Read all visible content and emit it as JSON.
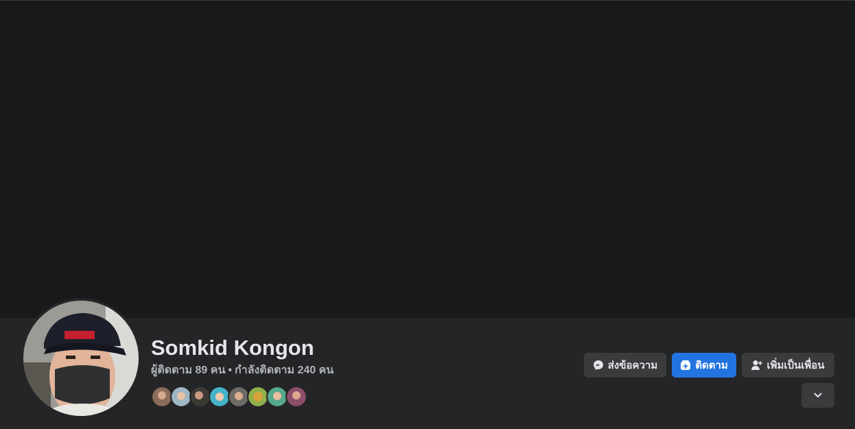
{
  "profile": {
    "name": "Somkid Kongon",
    "followers_text": "ผู้ติดตาม 89 คน",
    "separator": "•",
    "following_text": "กำลังติดตาม 240 คน"
  },
  "mutual_friends": [
    {
      "color": "#8a6d5a"
    },
    {
      "color": "#9fb6c4"
    },
    {
      "color": "#3d3a36"
    },
    {
      "color": "#45b3c9"
    },
    {
      "color": "#6e6a66"
    },
    {
      "color": "#d7a23a"
    },
    {
      "color": "#55a98c"
    },
    {
      "color": "#8c4e6a"
    }
  ],
  "actions": {
    "message_label": "ส่งข้อความ",
    "follow_label": "ติดตาม",
    "add_friend_label": "เพิ่มเป็นเพื่อน"
  },
  "icons": {
    "message": "messenger-icon",
    "follow": "follow-icon",
    "add_friend": "add-friend-icon",
    "more": "chevron-down-icon"
  },
  "colors": {
    "background": "#18191a",
    "header": "#242526",
    "button": "#3a3b3c",
    "primary": "#2374e1",
    "text_primary": "#e4e6eb",
    "text_secondary": "#b0b3b8"
  }
}
